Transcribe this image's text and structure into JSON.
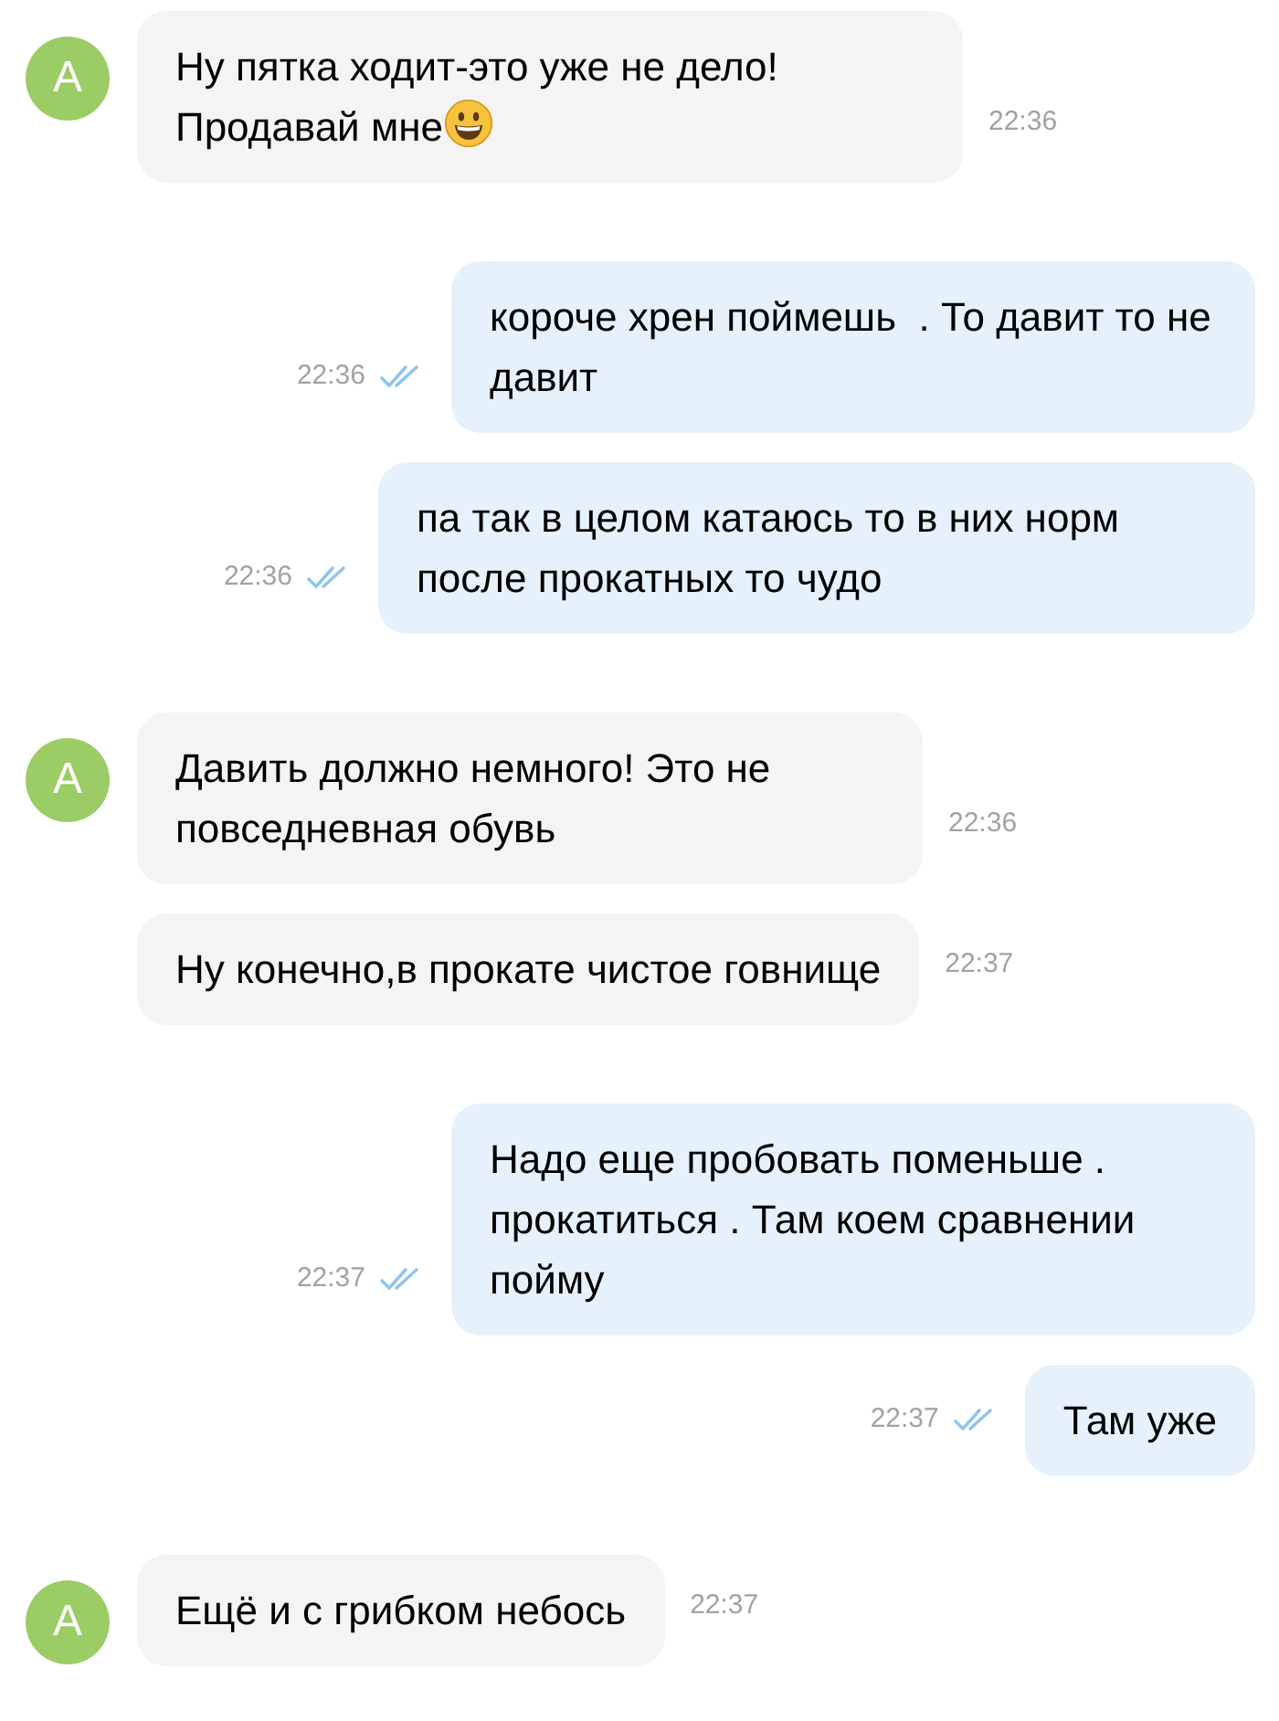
{
  "messages": [
    {
      "kind": "incoming",
      "avatar": "A",
      "text": "Ну пятка ходит-это уже не дело! Продавай мне",
      "emoji": true,
      "time": "22:36"
    },
    {
      "kind": "outgoing",
      "text": "короче хрен поймешь  . То давит то не давит",
      "time": "22:36",
      "read": true
    },
    {
      "kind": "outgoing",
      "text": "па так в целом катаюсь то в них норм после прокатных то чудо",
      "time": "22:36",
      "read": true
    },
    {
      "kind": "incoming",
      "avatar": "A",
      "text": "Давить должно немного! Это не повседневная обувь",
      "time": "22:36"
    },
    {
      "kind": "incoming",
      "text": "Ну конечно,в прокате чистое говнище",
      "time": "22:37"
    },
    {
      "kind": "outgoing",
      "text": "Надо еще пробовать поменьше . прокатиться . Там коем сравнении пойму",
      "time": "22:37",
      "read": true
    },
    {
      "kind": "outgoing",
      "text": "Там уже",
      "time": "22:37",
      "read": true
    },
    {
      "kind": "incoming",
      "avatar": "A",
      "text": "Ещё и с грибком небось",
      "time": "22:37"
    }
  ]
}
